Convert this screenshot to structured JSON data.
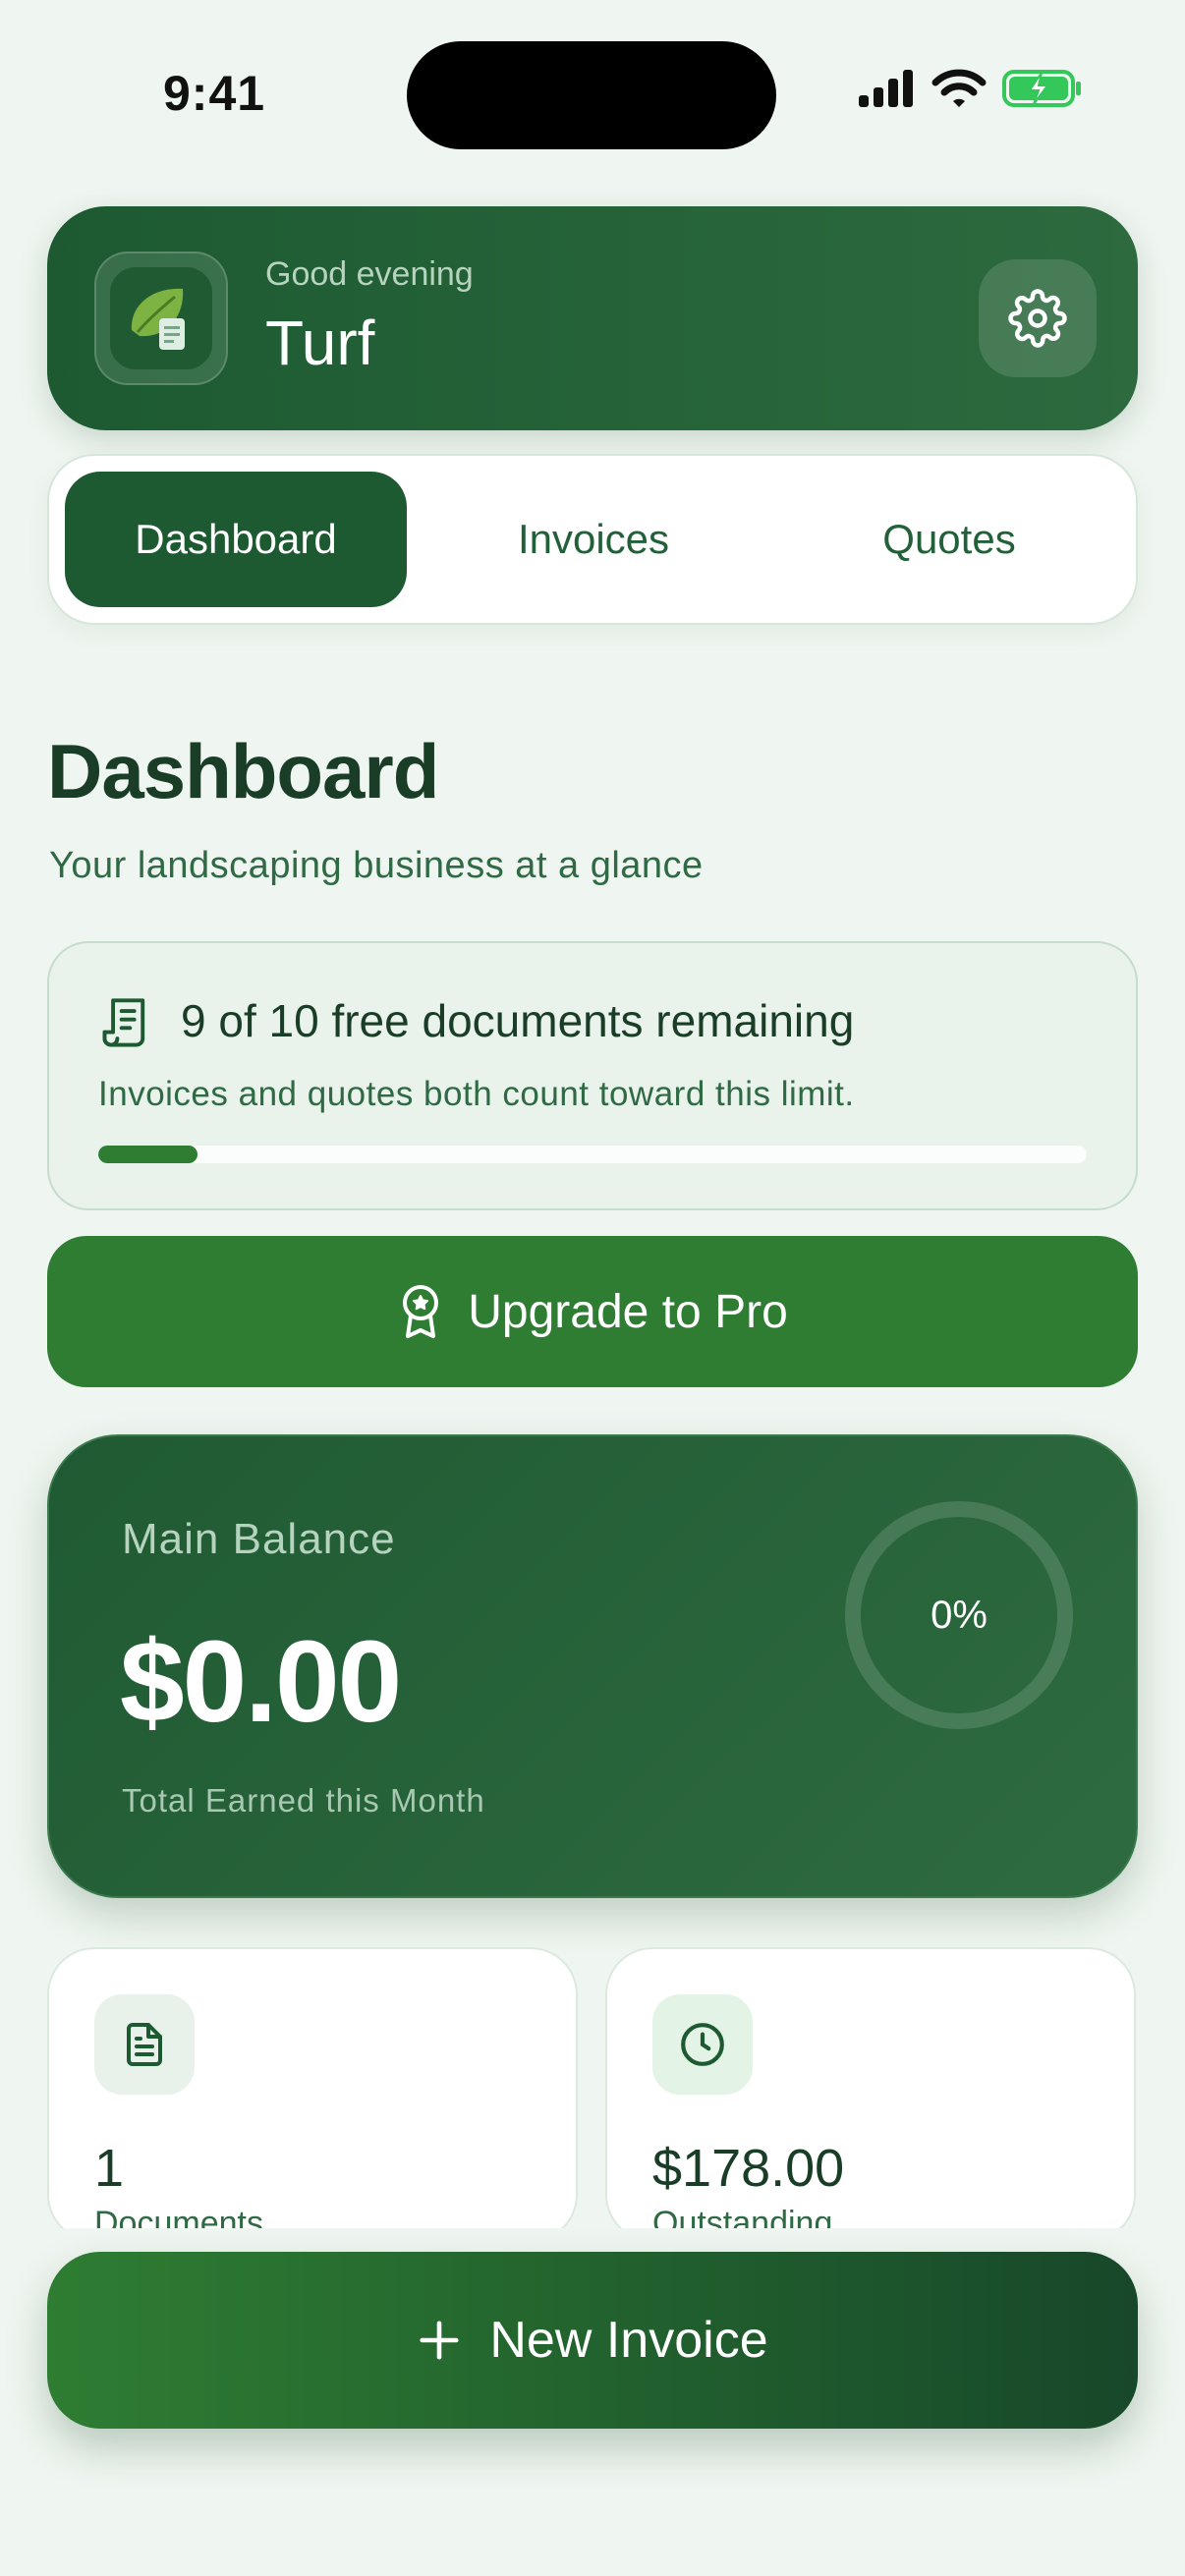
{
  "status": {
    "time": "9:41"
  },
  "header": {
    "greeting": "Good evening",
    "business_name": "Turf"
  },
  "tabs": [
    {
      "label": "Dashboard",
      "active": true
    },
    {
      "label": "Invoices",
      "active": false
    },
    {
      "label": "Quotes",
      "active": false
    }
  ],
  "page": {
    "title": "Dashboard",
    "subtitle": "Your landscaping business at a glance"
  },
  "limit": {
    "title": "9 of 10 free documents remaining",
    "note": "Invoices and quotes both count toward this limit.",
    "used_fraction": 0.1
  },
  "upgrade": {
    "label": "Upgrade to Pro"
  },
  "balance": {
    "label": "Main Balance",
    "amount": "$0.00",
    "caption": "Total Earned this Month",
    "progress_label": "0%",
    "progress": 0
  },
  "stats": [
    {
      "value": "1",
      "label": "Documents",
      "icon": "document-icon"
    },
    {
      "value": "$178.00",
      "label": "Outstanding",
      "icon": "clock-icon"
    }
  ],
  "new_invoice": {
    "label": "New Invoice"
  },
  "colors": {
    "primary": "#1d5a32",
    "accent": "#2e7d32",
    "background": "#eff5f0"
  }
}
